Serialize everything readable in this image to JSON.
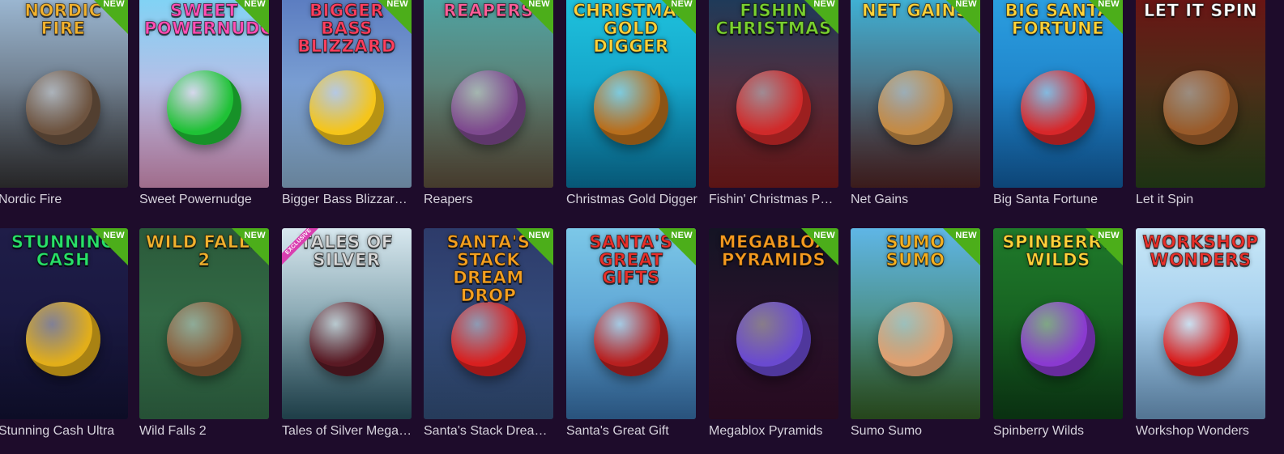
{
  "badges": {
    "new_label": "NEW",
    "exclusive_label": "EXCLUSIVE"
  },
  "rows": [
    [
      {
        "title": "Nordic Fire",
        "logo": "NORDIC FIRE",
        "is_new": true,
        "exclusive": false,
        "bg_top": "#9cb8d3",
        "bg_bottom": "#3b3a3c",
        "logo_color": "#f2b22e",
        "art_color": "#6e5440"
      },
      {
        "title": "Sweet Powernudge",
        "logo": "SWEET POWERNUDGE",
        "is_new": true,
        "exclusive": false,
        "bg_top": "#7fd3f5",
        "bg_bottom": "#f4a7d6",
        "logo_color": "#ff4fb5",
        "art_color": "#1fc236"
      },
      {
        "title": "Bigger Bass Blizzard - Christmas Catch",
        "logo": "BIGGER BASS BLIZZARD",
        "is_new": true,
        "exclusive": false,
        "bg_top": "#5b7cc0",
        "bg_bottom": "#9dc6e9",
        "logo_color": "#ff3f5e",
        "art_color": "#f5c51a"
      },
      {
        "title": "Reapers",
        "logo": "REAPERS",
        "is_new": true,
        "exclusive": false,
        "bg_top": "#4fa4a3",
        "bg_bottom": "#6a5a44",
        "logo_color": "#ff5f9a",
        "art_color": "#7e4a8f"
      },
      {
        "title": "Christmas Gold Digger",
        "logo": "CHRISTMAS GOLD DIGGER",
        "is_new": true,
        "exclusive": false,
        "bg_top": "#1fc2dd",
        "bg_bottom": "#0a86b5",
        "logo_color": "#ffd23a",
        "art_color": "#b86f1d"
      },
      {
        "title": "Fishin' Christmas Pots of Gold",
        "logo": "FISHIN CHRISTMAS",
        "is_new": true,
        "exclusive": false,
        "bg_top": "#1d3b5a",
        "bg_bottom": "#8b1f20",
        "logo_color": "#7ad130",
        "art_color": "#d02a2a"
      },
      {
        "title": "Net Gains",
        "logo": "NET GAINS",
        "is_new": true,
        "exclusive": false,
        "bg_top": "#3fb2d6",
        "bg_bottom": "#5a2a2a",
        "logo_color": "#ffd23a",
        "art_color": "#c48b45"
      },
      {
        "title": "Big Santa Fortune",
        "logo": "BIG SANTA FORTUNE",
        "is_new": true,
        "exclusive": false,
        "bg_top": "#2b9fe0",
        "bg_bottom": "#146ab6",
        "logo_color": "#ffd23a",
        "art_color": "#d8272a"
      },
      {
        "title": "Let it Spin",
        "logo": "LET IT SPIN",
        "is_new": false,
        "exclusive": false,
        "bg_top": "#6a1414",
        "bg_bottom": "#2d4c1d",
        "logo_color": "#ffffff",
        "art_color": "#9a5b2a"
      }
    ],
    [
      {
        "title": "Stunning Cash Ultra",
        "logo": "STUNNING CASH",
        "is_new": true,
        "exclusive": false,
        "bg_top": "#1f1d48",
        "bg_bottom": "#14143a",
        "logo_color": "#29e06a",
        "art_color": "#e2ae1a"
      },
      {
        "title": "Wild Falls 2",
        "logo": "WILD FALLS 2",
        "is_new": true,
        "exclusive": false,
        "bg_top": "#2b5a3a",
        "bg_bottom": "#3a7b52",
        "logo_color": "#f2b22e",
        "art_color": "#8a5a35"
      },
      {
        "title": "Tales of Silver Megaways",
        "logo": "TALES OF SILVER",
        "is_new": false,
        "exclusive": true,
        "bg_top": "#d8e8ef",
        "bg_bottom": "#2f5f6e",
        "logo_color": "#d9d9d9",
        "art_color": "#5a1a24"
      },
      {
        "title": "Santa's Stack Dream Drop",
        "logo": "SANTA'S STACK DREAM DROP",
        "is_new": true,
        "exclusive": false,
        "bg_top": "#2d3b6a",
        "bg_bottom": "#3a5a8a",
        "logo_color": "#f5a020",
        "art_color": "#d82020"
      },
      {
        "title": "Santa's Great Gift",
        "logo": "SANTA'S GREAT GIFTS",
        "is_new": true,
        "exclusive": false,
        "bg_top": "#7cc8e8",
        "bg_bottom": "#3f7fbf",
        "logo_color": "#e8302a",
        "art_color": "#b82020"
      },
      {
        "title": "Megablox Pyramids",
        "logo": "MEGABLOX PYRAMIDS",
        "is_new": true,
        "exclusive": false,
        "bg_top": "#141424",
        "bg_bottom": "#3a1030",
        "logo_color": "#f59a20",
        "art_color": "#6a4ad0"
      },
      {
        "title": "Sumo Sumo",
        "logo": "SUMO SUMO",
        "is_new": true,
        "exclusive": false,
        "bg_top": "#5fb6e6",
        "bg_bottom": "#3a6a2a",
        "logo_color": "#f5b020",
        "art_color": "#e0a070"
      },
      {
        "title": "Spinberry Wilds",
        "logo": "SPINBERRY WILDS",
        "is_new": true,
        "exclusive": false,
        "bg_top": "#1f7a2a",
        "bg_bottom": "#0f4a1a",
        "logo_color": "#ffd23a",
        "art_color": "#8a3ad0"
      },
      {
        "title": "Workshop Wonders",
        "logo": "WORKSHOP WONDERS",
        "is_new": false,
        "exclusive": false,
        "bg_top": "#c8e8f8",
        "bg_bottom": "#7fb2e0",
        "logo_color": "#e8302a",
        "art_color": "#d82020"
      }
    ]
  ]
}
